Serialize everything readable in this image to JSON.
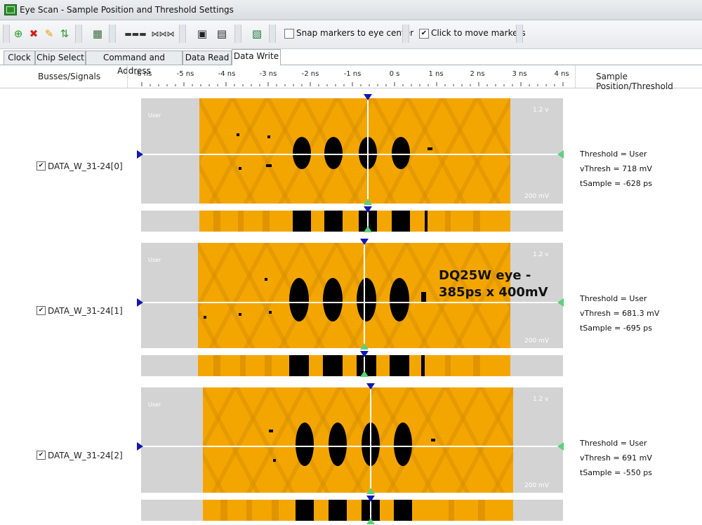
{
  "window": {
    "title": "Eye Scan - Sample Position and Threshold Settings"
  },
  "toolbar": {
    "icons": [
      "add-icon",
      "delete-icon",
      "edit-icon",
      "sort-icon",
      "table-icon",
      "signal-pattern-icon",
      "eye-pattern-icon",
      "save-icon",
      "load-icon",
      "excel-export-icon"
    ],
    "snap_label": "Snap markers to eye center",
    "snap_checked": false,
    "click_move_label": "Click to move markers",
    "click_move_checked": true
  },
  "tabs": [
    "Clock",
    "Chip Select",
    "Command and Address",
    "Data Read",
    "Data Write"
  ],
  "active_tab": "Data Write",
  "columns": {
    "signals": "Busses/Signals",
    "sample": "Sample Position/Threshold"
  },
  "ruler": {
    "labels": [
      "-6 ns",
      "-5 ns",
      "-4 ns",
      "-3 ns",
      "-2 ns",
      "-1 ns",
      "0 s",
      "1 ns",
      "2 ns",
      "3 ns",
      "4 ns"
    ]
  },
  "rows": [
    {
      "name": "DATA_W_31-24[0]",
      "checked": true,
      "user": "User",
      "volt_top": "1.2 v",
      "volt_bot": "200 mV",
      "threshold": "Threshold = User",
      "vthresh": "vThresh = 718 mV",
      "tsample": "tSample = -628 ps"
    },
    {
      "name": "DATA_W_31-24[1]",
      "checked": true,
      "user": "User",
      "volt_top": "1.2 v",
      "volt_bot": "200 mV",
      "threshold": "Threshold = User",
      "vthresh": "vThresh = 681.3 mV",
      "tsample": "tSample = -695 ps"
    },
    {
      "name": "DATA_W_31-24[2]",
      "checked": true,
      "user": "User",
      "volt_top": "1.2 v",
      "volt_bot": "200 mV",
      "threshold": "Threshold = User",
      "vthresh": "vThresh = 691 mV",
      "tsample": "tSample = -550 ps"
    }
  ],
  "annotation": {
    "line1": "DQ25W eye -",
    "line2": "385ps x 400mV"
  },
  "colors": {
    "eye_orange": "#f4a600",
    "marker_blue": "#1018b0",
    "marker_green": "#59d27a",
    "plot_gray": "#d3d3d3"
  }
}
